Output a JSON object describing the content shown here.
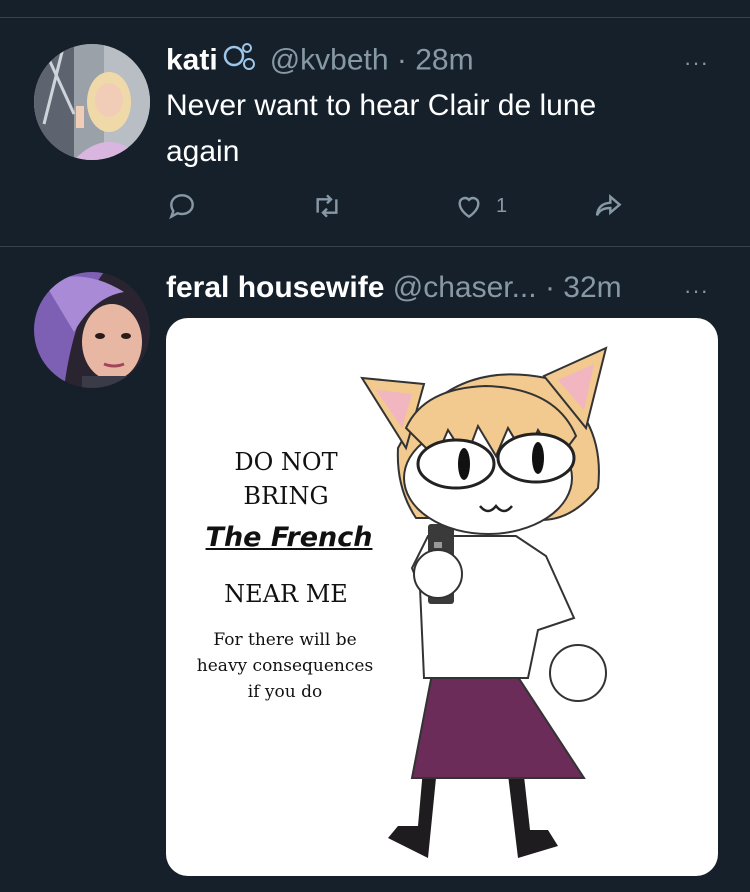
{
  "tweets": [
    {
      "display_name": "kati",
      "handle": "@kvbeth",
      "separator": "·",
      "time": "28m",
      "more": "···",
      "text_line1": "Never want to hear Clair de lune",
      "text_line2": "again",
      "like_count": "1",
      "icons": [
        "reply-icon",
        "retweet-icon",
        "like-icon",
        "share-icon",
        "bubbles-emoji-icon"
      ]
    },
    {
      "display_name": "feral housewife",
      "handle": "@chaser...",
      "separator": "·",
      "time": "32m",
      "more": "···",
      "media": {
        "line1": "DO NOT",
        "line2": "BRING",
        "line3": "The French",
        "line4": "NEAR ME",
        "line5": "For there will be",
        "line6": "heavy consequences",
        "line7": "if you do"
      }
    }
  ],
  "colors": {
    "background": "#15202b",
    "divider": "#38444d",
    "secondary_text": "#8899a6",
    "primary_text": "#ffffff",
    "skirt": "#6b2c5a",
    "hair": "#f2c98e"
  }
}
